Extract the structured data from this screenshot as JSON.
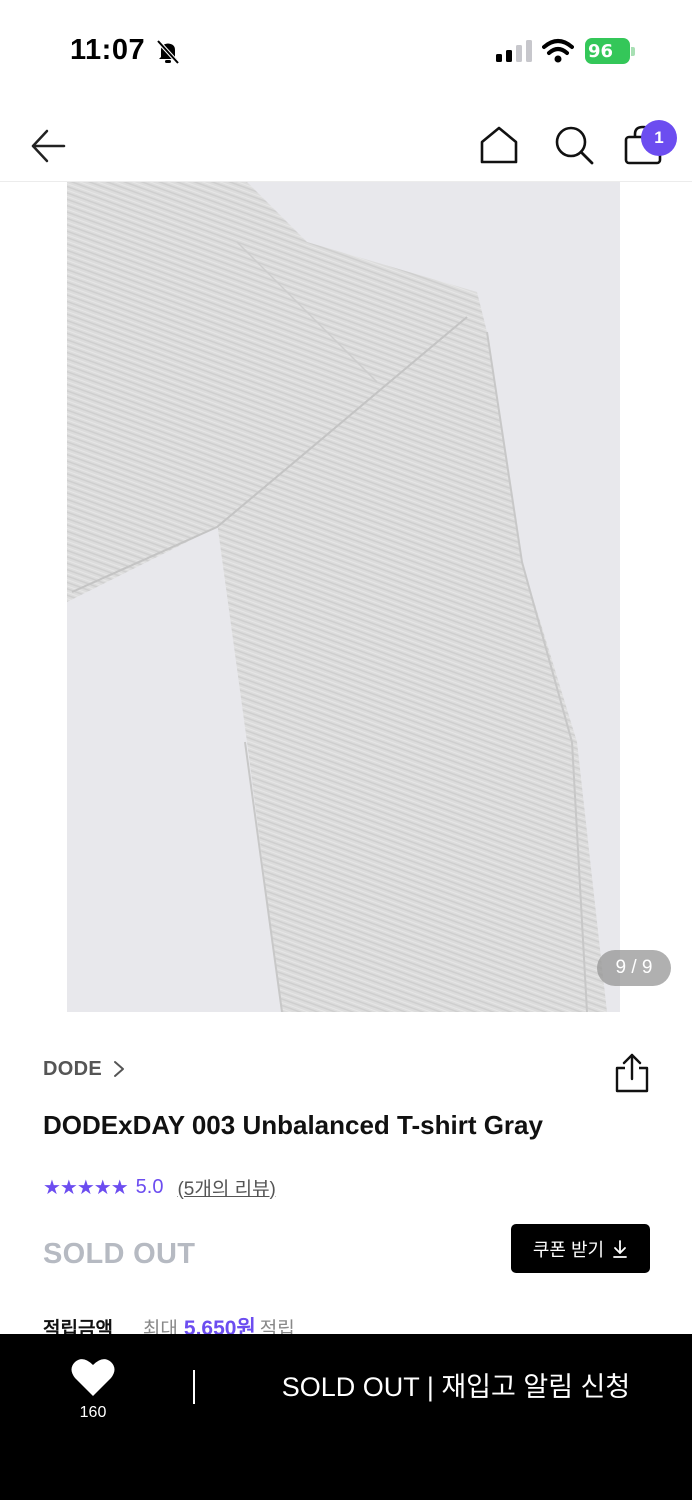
{
  "status_bar": {
    "time": "11:07",
    "battery_level": "96",
    "icons": [
      "bell-slash-icon",
      "cellular-signal-icon",
      "wifi-icon",
      "battery-charging-icon"
    ]
  },
  "nav": {
    "cart_count": "1",
    "icons": [
      "back-arrow-icon",
      "home-icon",
      "search-icon",
      "shopping-bag-icon"
    ]
  },
  "gallery": {
    "counter": "9 / 9"
  },
  "product": {
    "brand": "DODE",
    "title": "DODExDAY 003 Unbalanced T-shirt Gray",
    "stars": "★★★★★",
    "rating": "5.0",
    "review_link": "(5개의 리뷰)",
    "status": "SOLD OUT",
    "coupon_label": "쿠폰 받기",
    "points": {
      "label": "적립금액",
      "prefix": "최대",
      "amount": "5,650원",
      "suffix": "적립"
    }
  },
  "bottom_bar": {
    "like_count": "160",
    "action_label": "SOLD OUT | 재입고 알림 신청"
  },
  "colors": {
    "accent": "#6c4df0",
    "soldout_gray": "#b6bac2",
    "battery_green": "#34c759",
    "bottom_bar": "#000000"
  }
}
